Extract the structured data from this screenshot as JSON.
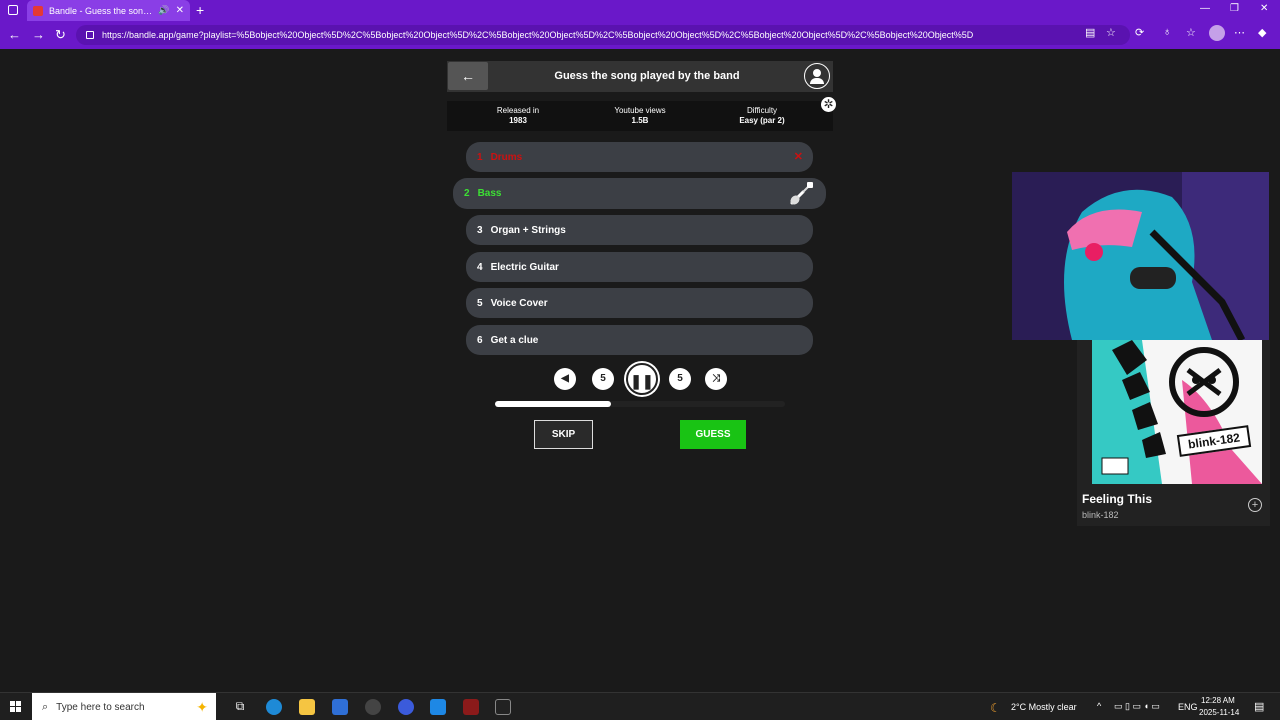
{
  "browser": {
    "tab_title": "Bandle - Guess the song, one",
    "url": "https://bandle.app/game?playlist=%5Bobject%20Object%5D%2C%5Bobject%20Object%5D%2C%5Bobject%20Object%5D%2C%5Bobject%20Object%5D%2C%5Bobject%20Object%5D%2C%5Bobject%20Object%5D"
  },
  "game": {
    "title": "Guess the song played by the band",
    "info": [
      {
        "label": "Released in",
        "value": "1983"
      },
      {
        "label": "Youtube views",
        "value": "1.5B"
      },
      {
        "label": "Difficulty",
        "value": "Easy (par 2)"
      }
    ],
    "tracks": [
      {
        "num": "1",
        "label": "Drums",
        "state": "missed"
      },
      {
        "num": "2",
        "label": "Bass",
        "state": "current"
      },
      {
        "num": "3",
        "label": "Organ + Strings",
        "state": "locked"
      },
      {
        "num": "4",
        "label": "Electric Guitar",
        "state": "locked"
      },
      {
        "num": "5",
        "label": "Voice Cover",
        "state": "locked"
      },
      {
        "num": "6",
        "label": "Get a clue",
        "state": "locked"
      }
    ],
    "controls": {
      "rewind_seconds": "5",
      "forward_seconds": "5"
    },
    "progress": 0.4,
    "skip_label": "SKIP",
    "guess_label": "GUESS"
  },
  "now_playing": {
    "song": "Feeling This",
    "artist": "blink-182",
    "album_text": "blink-182"
  },
  "taskbar": {
    "search_placeholder": "Type here to search",
    "weather": "2°C  Mostly clear",
    "lang": "ENG",
    "time": "12:28 AM",
    "date": "2025-11-14"
  },
  "colors": {
    "browser_chrome": "#6a18c9",
    "missed": "#cc1111",
    "current": "#3ce034",
    "guess_button": "#19c314"
  }
}
